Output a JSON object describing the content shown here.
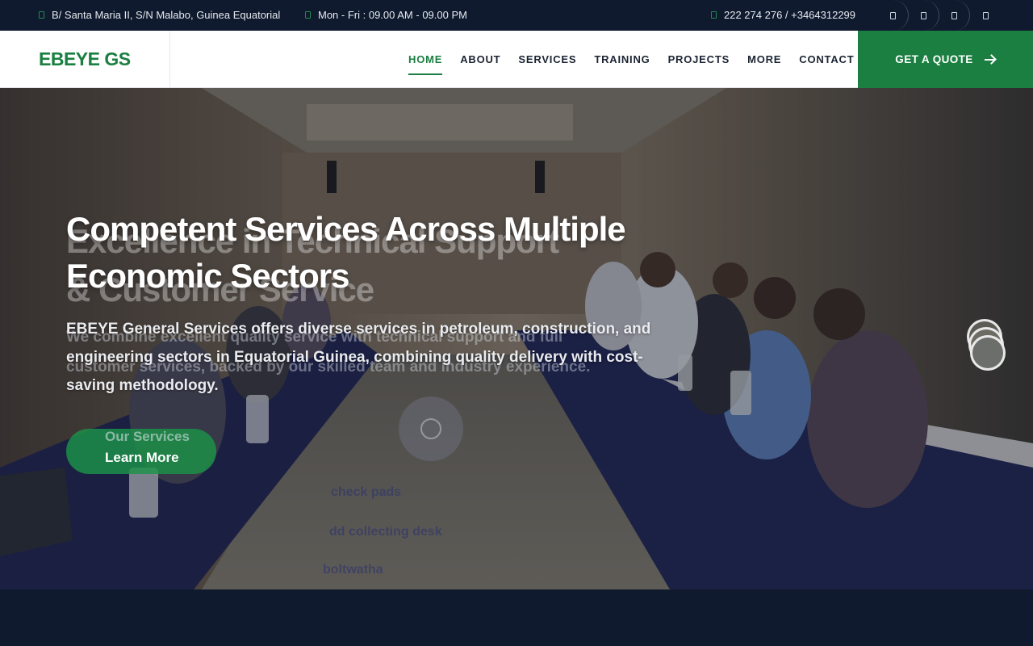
{
  "topbar": {
    "address": "B/ Santa Maria II, S/N Malabo, Guinea Equatorial",
    "hours": "Mon - Fri : 09.00 AM - 09.00 PM",
    "phone": "222 274 276 / +3464312299",
    "social_icons": [
      "social-icon-1",
      "social-icon-2",
      "social-icon-3",
      "social-icon-4"
    ]
  },
  "nav": {
    "logo": "EBEYE GS",
    "items": [
      {
        "label": "HOME",
        "active": true
      },
      {
        "label": "ABOUT"
      },
      {
        "label": "SERVICES"
      },
      {
        "label": "TRAINING"
      },
      {
        "label": "PROJECTS"
      },
      {
        "label": "MORE"
      },
      {
        "label": "CONTACT"
      }
    ],
    "quote_label": "GET A QUOTE"
  },
  "hero": {
    "title": "Competent Services Across Multiple Economic Sectors",
    "description": "EBEYE General Services offers diverse services in petroleum, construction, and engineering sectors in Equatorial Guinea, combining quality delivery with cost-saving methodology.",
    "cta_label": "Learn More",
    "previous_slide": {
      "title_line1": "Excellence in Technical Support",
      "title_line2": "& Customer Service",
      "desc_line1": "We combine excellent quality service with technical support and full",
      "desc_line2": "customer services, backed by our skilled team and industry experience.",
      "cta_label": "Our Services"
    },
    "background_text": [
      "check pads",
      "dd collecting desk",
      "boltwatha"
    ]
  },
  "colors": {
    "brand_green": "#1a7f41",
    "dark_navy": "#0f1a2e"
  }
}
